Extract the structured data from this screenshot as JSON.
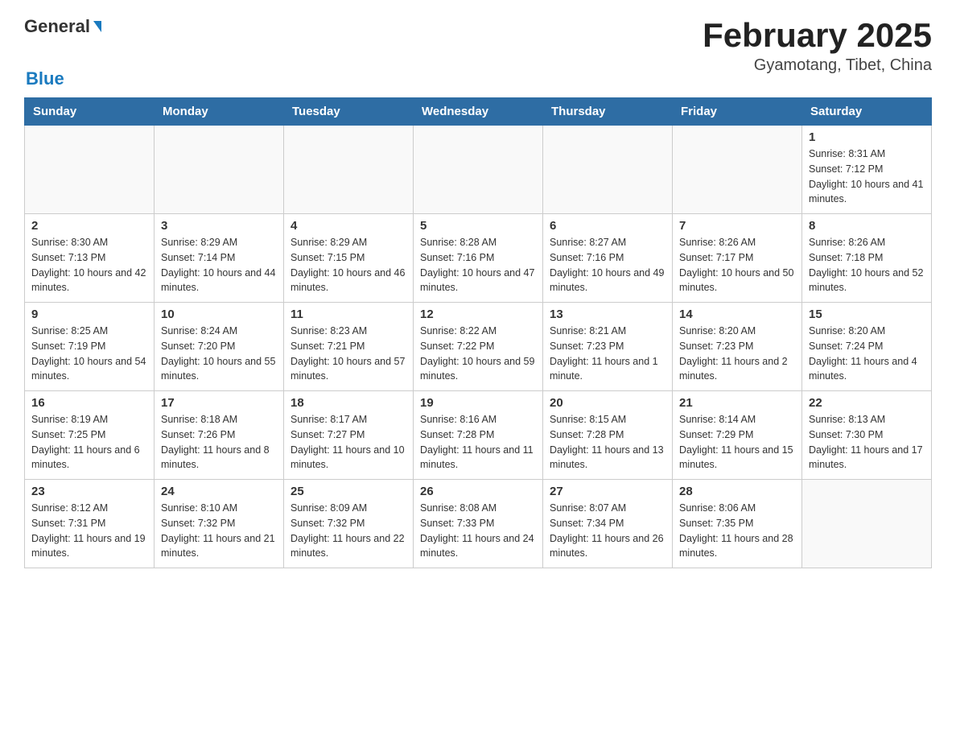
{
  "logo": {
    "general": "General",
    "blue": "Blue"
  },
  "title": "February 2025",
  "location": "Gyamotang, Tibet, China",
  "days_of_week": [
    "Sunday",
    "Monday",
    "Tuesday",
    "Wednesday",
    "Thursday",
    "Friday",
    "Saturday"
  ],
  "weeks": [
    [
      {
        "day": "",
        "info": ""
      },
      {
        "day": "",
        "info": ""
      },
      {
        "day": "",
        "info": ""
      },
      {
        "day": "",
        "info": ""
      },
      {
        "day": "",
        "info": ""
      },
      {
        "day": "",
        "info": ""
      },
      {
        "day": "1",
        "info": "Sunrise: 8:31 AM\nSunset: 7:12 PM\nDaylight: 10 hours and 41 minutes."
      }
    ],
    [
      {
        "day": "2",
        "info": "Sunrise: 8:30 AM\nSunset: 7:13 PM\nDaylight: 10 hours and 42 minutes."
      },
      {
        "day": "3",
        "info": "Sunrise: 8:29 AM\nSunset: 7:14 PM\nDaylight: 10 hours and 44 minutes."
      },
      {
        "day": "4",
        "info": "Sunrise: 8:29 AM\nSunset: 7:15 PM\nDaylight: 10 hours and 46 minutes."
      },
      {
        "day": "5",
        "info": "Sunrise: 8:28 AM\nSunset: 7:16 PM\nDaylight: 10 hours and 47 minutes."
      },
      {
        "day": "6",
        "info": "Sunrise: 8:27 AM\nSunset: 7:16 PM\nDaylight: 10 hours and 49 minutes."
      },
      {
        "day": "7",
        "info": "Sunrise: 8:26 AM\nSunset: 7:17 PM\nDaylight: 10 hours and 50 minutes."
      },
      {
        "day": "8",
        "info": "Sunrise: 8:26 AM\nSunset: 7:18 PM\nDaylight: 10 hours and 52 minutes."
      }
    ],
    [
      {
        "day": "9",
        "info": "Sunrise: 8:25 AM\nSunset: 7:19 PM\nDaylight: 10 hours and 54 minutes."
      },
      {
        "day": "10",
        "info": "Sunrise: 8:24 AM\nSunset: 7:20 PM\nDaylight: 10 hours and 55 minutes."
      },
      {
        "day": "11",
        "info": "Sunrise: 8:23 AM\nSunset: 7:21 PM\nDaylight: 10 hours and 57 minutes."
      },
      {
        "day": "12",
        "info": "Sunrise: 8:22 AM\nSunset: 7:22 PM\nDaylight: 10 hours and 59 minutes."
      },
      {
        "day": "13",
        "info": "Sunrise: 8:21 AM\nSunset: 7:23 PM\nDaylight: 11 hours and 1 minute."
      },
      {
        "day": "14",
        "info": "Sunrise: 8:20 AM\nSunset: 7:23 PM\nDaylight: 11 hours and 2 minutes."
      },
      {
        "day": "15",
        "info": "Sunrise: 8:20 AM\nSunset: 7:24 PM\nDaylight: 11 hours and 4 minutes."
      }
    ],
    [
      {
        "day": "16",
        "info": "Sunrise: 8:19 AM\nSunset: 7:25 PM\nDaylight: 11 hours and 6 minutes."
      },
      {
        "day": "17",
        "info": "Sunrise: 8:18 AM\nSunset: 7:26 PM\nDaylight: 11 hours and 8 minutes."
      },
      {
        "day": "18",
        "info": "Sunrise: 8:17 AM\nSunset: 7:27 PM\nDaylight: 11 hours and 10 minutes."
      },
      {
        "day": "19",
        "info": "Sunrise: 8:16 AM\nSunset: 7:28 PM\nDaylight: 11 hours and 11 minutes."
      },
      {
        "day": "20",
        "info": "Sunrise: 8:15 AM\nSunset: 7:28 PM\nDaylight: 11 hours and 13 minutes."
      },
      {
        "day": "21",
        "info": "Sunrise: 8:14 AM\nSunset: 7:29 PM\nDaylight: 11 hours and 15 minutes."
      },
      {
        "day": "22",
        "info": "Sunrise: 8:13 AM\nSunset: 7:30 PM\nDaylight: 11 hours and 17 minutes."
      }
    ],
    [
      {
        "day": "23",
        "info": "Sunrise: 8:12 AM\nSunset: 7:31 PM\nDaylight: 11 hours and 19 minutes."
      },
      {
        "day": "24",
        "info": "Sunrise: 8:10 AM\nSunset: 7:32 PM\nDaylight: 11 hours and 21 minutes."
      },
      {
        "day": "25",
        "info": "Sunrise: 8:09 AM\nSunset: 7:32 PM\nDaylight: 11 hours and 22 minutes."
      },
      {
        "day": "26",
        "info": "Sunrise: 8:08 AM\nSunset: 7:33 PM\nDaylight: 11 hours and 24 minutes."
      },
      {
        "day": "27",
        "info": "Sunrise: 8:07 AM\nSunset: 7:34 PM\nDaylight: 11 hours and 26 minutes."
      },
      {
        "day": "28",
        "info": "Sunrise: 8:06 AM\nSunset: 7:35 PM\nDaylight: 11 hours and 28 minutes."
      },
      {
        "day": "",
        "info": ""
      }
    ]
  ]
}
